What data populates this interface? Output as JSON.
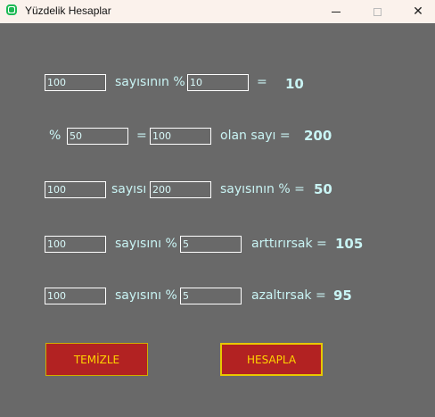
{
  "window": {
    "title": "Yüzdelik Hesaplar",
    "minimize": "─",
    "maximize": "□",
    "close": "✕"
  },
  "rows": [
    {
      "input1": "100",
      "label1": "sayısının %",
      "input2": "10",
      "label2": "=",
      "result": "10"
    },
    {
      "prefix": "%",
      "input1": "50",
      "label1": "=",
      "input2": "100",
      "label2": "olan sayı =",
      "result": "200"
    },
    {
      "input1": "100",
      "label1": "sayısı",
      "input2": "200",
      "label2": "sayısının % =",
      "result": "50"
    },
    {
      "input1": "100",
      "label1": "sayısını %",
      "input2": "5",
      "label2": "arttırırsak =",
      "result": "105"
    },
    {
      "input1": "100",
      "label1": "sayısını %",
      "input2": "5",
      "label2": "azaltırsak =",
      "result": "95"
    }
  ],
  "buttons": {
    "clear": "TEMİZLE",
    "calculate": "HESAPLA"
  }
}
